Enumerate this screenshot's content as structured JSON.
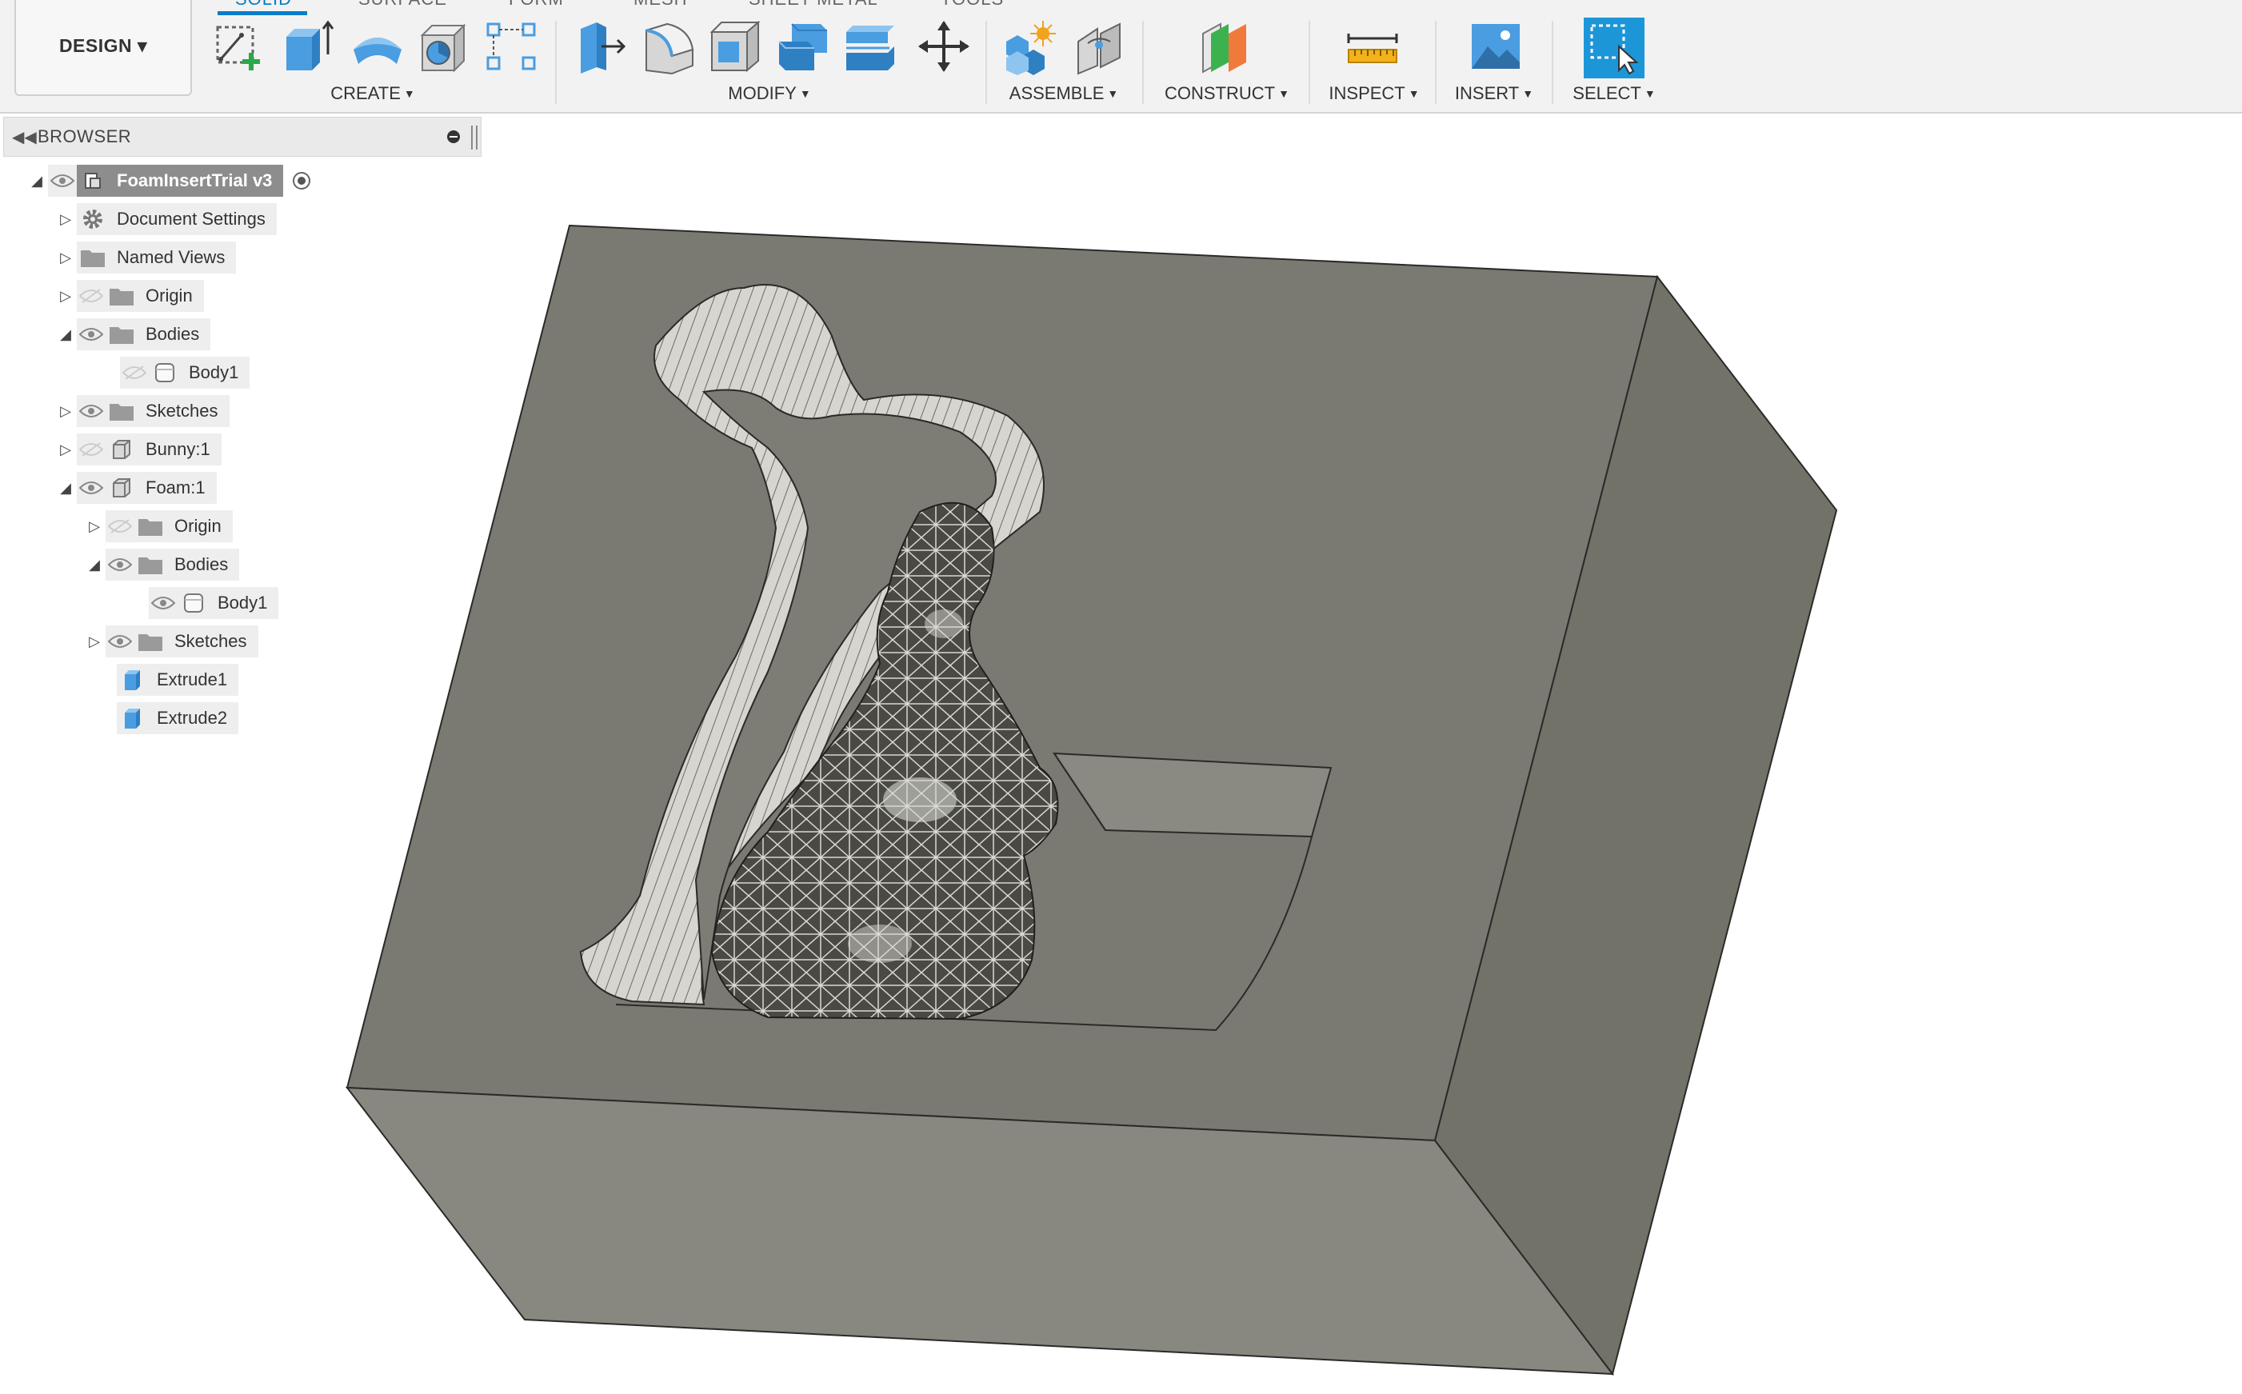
{
  "workspace": {
    "label": "DESIGN ▾"
  },
  "tabs": [
    {
      "label": "SOLID",
      "active": true
    },
    {
      "label": "SURFACE"
    },
    {
      "label": "FORM"
    },
    {
      "label": "MESH"
    },
    {
      "label": "SHEET METAL"
    },
    {
      "label": "TOOLS"
    }
  ],
  "toolbar": {
    "groups": [
      {
        "label": "CREATE",
        "tools": [
          "create-sketch-icon",
          "extrude-icon",
          "revolve-icon",
          "hole-icon",
          "pattern-icon"
        ]
      },
      {
        "label": "MODIFY",
        "tools": [
          "press-pull-icon",
          "fillet-icon",
          "shell-icon",
          "combine-icon",
          "offset-face-icon",
          "move-icon"
        ]
      },
      {
        "label": "ASSEMBLE",
        "tools": [
          "new-component-icon",
          "joint-icon"
        ]
      },
      {
        "label": "CONSTRUCT",
        "tools": [
          "offset-plane-icon"
        ]
      },
      {
        "label": "INSPECT",
        "tools": [
          "measure-icon"
        ]
      },
      {
        "label": "INSERT",
        "tools": [
          "insert-image-icon"
        ]
      },
      {
        "label": "SELECT",
        "tools": [
          "select-icon"
        ]
      }
    ]
  },
  "browser": {
    "title": "BROWSER",
    "tree": [
      {
        "label": "FoamInsertTrial v3",
        "icon": "document-icon",
        "expanded": true,
        "visible": true
      },
      {
        "label": "Document Settings",
        "icon": "gear-icon"
      },
      {
        "label": "Named Views",
        "icon": "folder-icon"
      },
      {
        "label": "Origin",
        "icon": "folder-icon",
        "visible": false
      },
      {
        "label": "Bodies",
        "icon": "folder-icon",
        "expanded": true,
        "visible": true
      },
      {
        "label": "Body1",
        "icon": "body-icon",
        "visible": false
      },
      {
        "label": "Sketches",
        "icon": "folder-icon",
        "visible": true
      },
      {
        "label": "Bunny:1",
        "icon": "component-icon",
        "visible": false
      },
      {
        "label": "Foam:1",
        "icon": "component-icon",
        "expanded": true,
        "visible": true
      },
      {
        "label": "Origin",
        "icon": "folder-icon",
        "visible": false
      },
      {
        "label": "Bodies",
        "icon": "folder-icon",
        "expanded": true,
        "visible": true
      },
      {
        "label": "Body1",
        "icon": "body-icon",
        "visible": true
      },
      {
        "label": "Sketches",
        "icon": "folder-icon",
        "visible": true
      },
      {
        "label": "Extrude1",
        "icon": "extrude-feature-icon"
      },
      {
        "label": "Extrude2",
        "icon": "extrude-feature-icon"
      }
    ]
  },
  "colors": {
    "accent": "#0a7cc9",
    "tool_blue": "#4a9de0",
    "model_top": "#7b7a72",
    "model_front": "#898881",
    "model_side": "#737268"
  }
}
